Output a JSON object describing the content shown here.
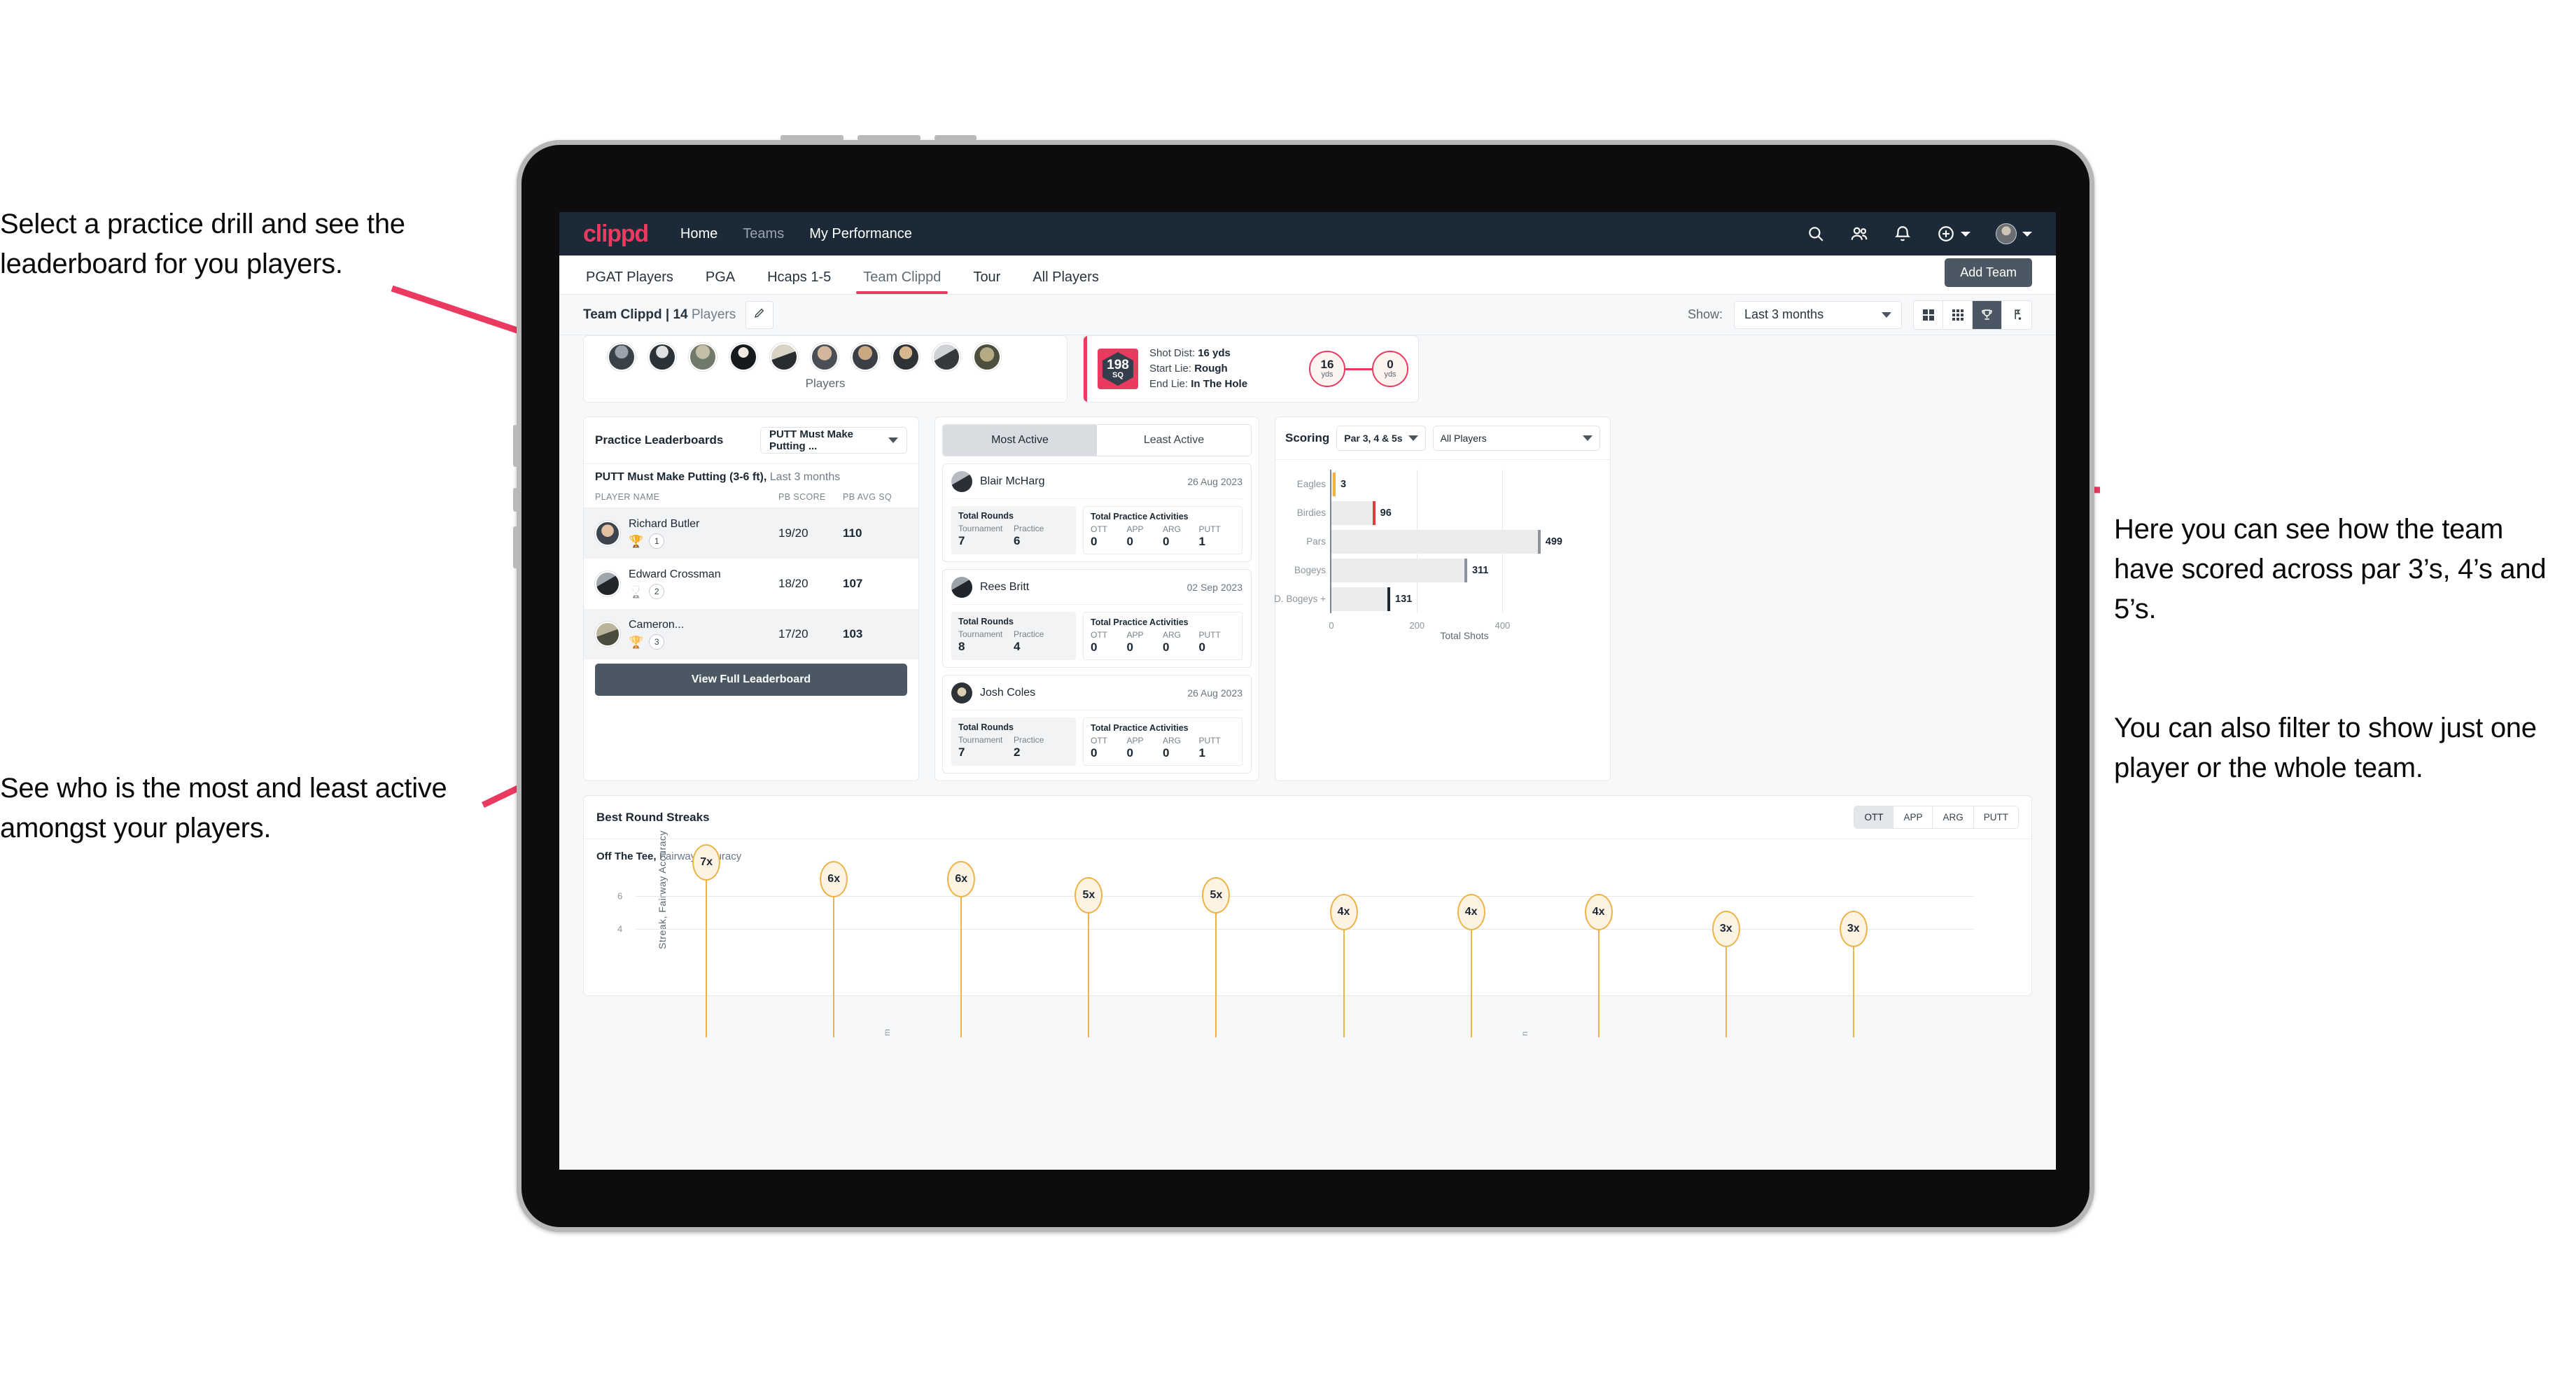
{
  "annotations": {
    "left_top": "Select a practice drill and see the leaderboard for you players.",
    "left_bottom": "See who is the most and least active amongst your players.",
    "right_top": "Here you can see how the team have scored across par 3’s, 4’s and 5’s.",
    "right_bottom": "You can also filter to show just one player or the whole team."
  },
  "navbar": {
    "logo": "clippd",
    "links": [
      {
        "label": "Home",
        "active": true
      },
      {
        "label": "Teams",
        "active": false
      },
      {
        "label": "My Performance",
        "active": true
      }
    ],
    "icons": [
      "search-icon",
      "people-icon",
      "bell-icon",
      "plus-circle-icon",
      "avatar"
    ]
  },
  "tabs": [
    {
      "label": "PGAT Players",
      "active": false
    },
    {
      "label": "PGA",
      "active": false
    },
    {
      "label": "Hcaps 1-5",
      "active": false
    },
    {
      "label": "Team Clippd",
      "active": true
    },
    {
      "label": "Tour",
      "active": false
    },
    {
      "label": "All Players",
      "active": false
    }
  ],
  "add_team_button": "Add Team",
  "subbar": {
    "team_label_bold": "Team Clippd | 14",
    "team_label_light": " Players",
    "edit_icon": "pencil-icon",
    "show_label": "Show:",
    "show_value": "Last 3 months",
    "view_buttons": [
      {
        "name": "grid-large-icon",
        "active": false
      },
      {
        "name": "grid-small-icon",
        "active": false
      },
      {
        "name": "trophy-icon",
        "active": true
      },
      {
        "name": "golf-flag-icon",
        "active": false
      }
    ]
  },
  "players_card": {
    "caption": "Players",
    "avatar_count": 10
  },
  "shot_card": {
    "badge_value": "198",
    "badge_unit": "SQ",
    "lines": [
      {
        "label": "Shot Dist:",
        "value": "16 yds"
      },
      {
        "label": "Start Lie:",
        "value": "Rough"
      },
      {
        "label": "End Lie:",
        "value": "In The Hole"
      }
    ],
    "start_dist": "16",
    "start_unit": "yds",
    "end_dist": "0",
    "end_unit": "yds"
  },
  "leaderboard": {
    "title": "Practice Leaderboards",
    "drill_select": "PUTT Must Make Putting ...",
    "subtitle_bold": "PUTT Must Make Putting (3-6 ft),",
    "subtitle_light": " Last 3 months",
    "columns": [
      "PLAYER NAME",
      "PB SCORE",
      "PB AVG SQ"
    ],
    "rows": [
      {
        "name": "Richard Butler",
        "trophy": "🏆",
        "rank": "1",
        "pb_score": "19/20",
        "pb_avg_sq": "110"
      },
      {
        "name": "Edward Crossman",
        "trophy": "🏆",
        "rank": "2",
        "pb_score": "18/20",
        "pb_avg_sq": "107"
      },
      {
        "name": "Cameron...",
        "trophy": "🏆",
        "rank": "3",
        "pb_score": "17/20",
        "pb_avg_sq": "103"
      }
    ],
    "button": "View Full Leaderboard"
  },
  "activity": {
    "tabs": [
      {
        "label": "Most Active",
        "active": true
      },
      {
        "label": "Least Active",
        "active": false
      }
    ],
    "rounds_title": "Total Rounds",
    "practice_title": "Total Practice Activities",
    "rounds_keys": [
      "Tournament",
      "Practice"
    ],
    "practice_keys": [
      "OTT",
      "APP",
      "ARG",
      "PUTT"
    ],
    "items": [
      {
        "name": "Blair McHarg",
        "date": "26 Aug 2023",
        "tournament": "7",
        "practice": "6",
        "ott": "0",
        "app": "0",
        "arg": "0",
        "putt": "1"
      },
      {
        "name": "Rees Britt",
        "date": "02 Sep 2023",
        "tournament": "8",
        "practice": "4",
        "ott": "0",
        "app": "0",
        "arg": "0",
        "putt": "0"
      },
      {
        "name": "Josh Coles",
        "date": "26 Aug 2023",
        "tournament": "7",
        "practice": "2",
        "ott": "0",
        "app": "0",
        "arg": "0",
        "putt": "1"
      }
    ]
  },
  "scoring": {
    "title": "Scoring",
    "par_select": "Par 3, 4 & 5s",
    "player_select": "All Players"
  },
  "streaks": {
    "title": "Best Round Streaks",
    "segments": [
      {
        "label": "OTT",
        "active": true
      },
      {
        "label": "APP",
        "active": false
      },
      {
        "label": "ARG",
        "active": false
      },
      {
        "label": "PUTT",
        "active": false
      }
    ],
    "sub_bold": "Off The Tee,",
    "sub_light": " Fairway Accuracy"
  },
  "chart_data": [
    {
      "type": "bar",
      "orientation": "horizontal",
      "title": "Scoring",
      "categories": [
        "Eagles",
        "Birdies",
        "Pars",
        "Bogeys",
        "D. Bogeys +"
      ],
      "values": [
        3,
        96,
        499,
        311,
        131
      ],
      "bar_cap_colors": [
        "#edb349",
        "#e03c3c",
        "#8a949c",
        "#8a949c",
        "#1b2733"
      ],
      "xlabel": "Total Shots",
      "ylabel": "",
      "xlim": [
        0,
        540
      ],
      "xticks": [
        0,
        200,
        400
      ],
      "grid": true,
      "legend": "none"
    },
    {
      "type": "bar",
      "variant": "lollipop",
      "title": "Best Round Streaks",
      "subtitle": "Off The Tee, Fairway Accuracy",
      "categories": [
        "p1",
        "p2",
        "p3",
        "p4",
        "p5",
        "p6",
        "p7",
        "p8",
        "p9",
        "p10"
      ],
      "values": [
        7,
        6,
        6,
        5,
        5,
        4,
        4,
        4,
        3,
        3
      ],
      "labels": [
        "7x",
        "6x",
        "6x",
        "5x",
        "5x",
        "4x",
        "4x",
        "4x",
        "3x",
        "3x"
      ],
      "ylabel": "Streak, Fairway Accuracy",
      "xlabel": "",
      "ylim": [
        0,
        8
      ],
      "yticks": [
        4,
        6
      ],
      "grid": true,
      "legend": "none",
      "marker_color": "#edb349"
    }
  ]
}
